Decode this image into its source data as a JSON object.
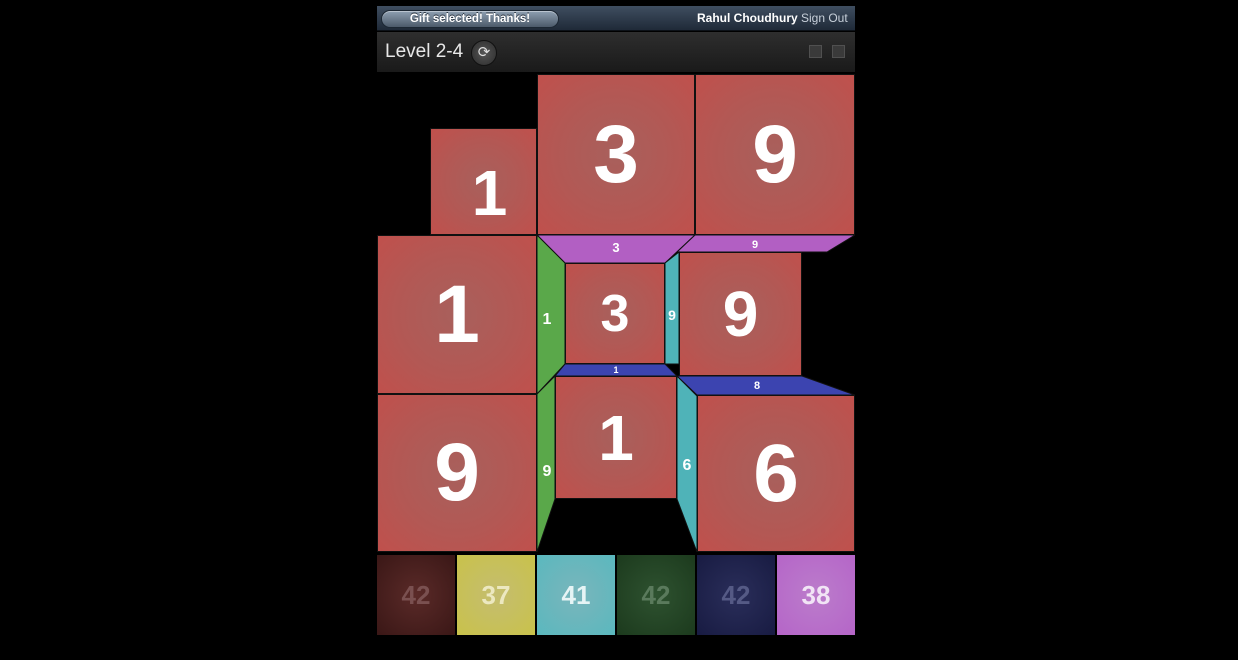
{
  "topbar": {
    "gift_label": "Gift selected! Thanks!",
    "user_name": "Rahul Choudhury",
    "sign_out": "Sign Out"
  },
  "levelbar": {
    "level": "Level 2-4",
    "refresh_icon": "refresh-icon"
  },
  "board": {
    "tiles": [
      {
        "value": "1"
      },
      {
        "value": "3"
      },
      {
        "value": "9"
      },
      {
        "value": "1"
      },
      {
        "value": "3"
      },
      {
        "value": "9"
      },
      {
        "value": "9"
      },
      {
        "value": "1"
      },
      {
        "value": "6"
      }
    ],
    "faces": [
      "3",
      "9",
      "1",
      "3",
      "9",
      "1",
      "9",
      "6",
      "3",
      "9",
      "8"
    ],
    "colors": {
      "tile": "#b35854",
      "top_face": "#b25fc3",
      "left_face": "#5aa84a",
      "right_face": "#4fb3b8",
      "bottom_face": "#3c44b0"
    }
  },
  "scores": [
    {
      "value": "42",
      "color": "#4a2020"
    },
    {
      "value": "37",
      "color": "#c9c24a"
    },
    {
      "value": "41",
      "color": "#5ab8be"
    },
    {
      "value": "42",
      "color": "#244a26"
    },
    {
      "value": "42",
      "color": "#20244e"
    },
    {
      "value": "38",
      "color": "#b565c8"
    }
  ]
}
